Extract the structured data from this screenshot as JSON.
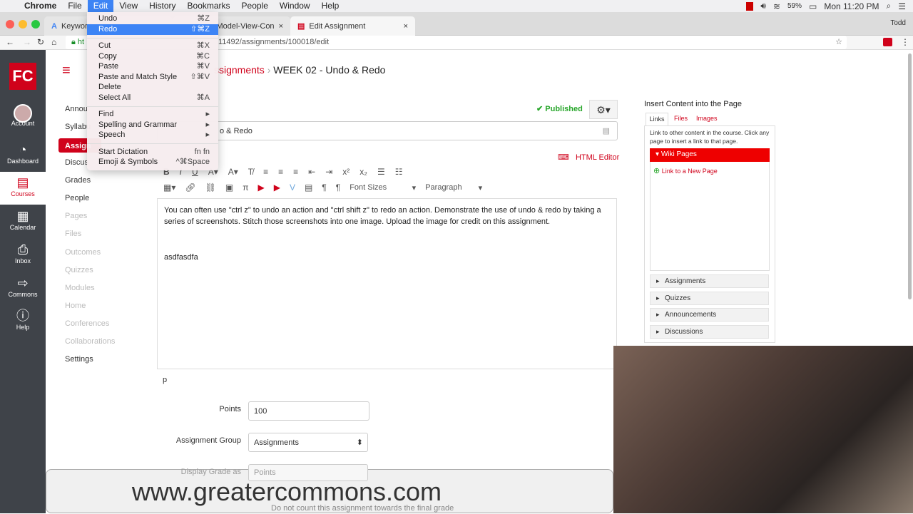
{
  "menubar": {
    "items": [
      "Chrome",
      "File",
      "Edit",
      "View",
      "History",
      "Bookmarks",
      "People",
      "Window",
      "Help"
    ],
    "active": "Edit",
    "battery": "59%",
    "clock": "Mon 11:20 PM"
  },
  "browser": {
    "tabs": [
      "Keyword",
      "e Model-View-Con",
      "Edit Assignment"
    ],
    "user": "Todd",
    "url_left": "ht",
    "url": "11492/assignments/100018/edit"
  },
  "edit_menu": [
    {
      "label": "Undo",
      "shortcut": "⌘Z"
    },
    {
      "label": "Redo",
      "shortcut": "⇧⌘Z",
      "highlighted": true
    },
    {
      "label": "Cut",
      "shortcut": "⌘X"
    },
    {
      "label": "Copy",
      "shortcut": "⌘C"
    },
    {
      "label": "Paste",
      "shortcut": "⌘V"
    },
    {
      "label": "Paste and Match Style",
      "shortcut": "⇧⌘V"
    },
    {
      "label": "Delete",
      "shortcut": ""
    },
    {
      "label": "Select All",
      "shortcut": "⌘A"
    },
    {
      "label": "Find",
      "shortcut": "▸"
    },
    {
      "label": "Spelling and Grammar",
      "shortcut": "▸"
    },
    {
      "label": "Speech",
      "shortcut": "▸"
    },
    {
      "label": "Start Dictation",
      "shortcut": "fn fn"
    },
    {
      "label": "Emoji & Symbols",
      "shortcut": "^⌘Space"
    }
  ],
  "global_nav": [
    {
      "label": "Account",
      "icon": "avatar"
    },
    {
      "label": "Dashboard",
      "icon": "dashboard-icon"
    },
    {
      "label": "Courses",
      "icon": "courses-icon",
      "selected": true
    },
    {
      "label": "Calendar",
      "icon": "calendar-icon"
    },
    {
      "label": "Inbox",
      "icon": "inbox-icon"
    },
    {
      "label": "Commons",
      "icon": "commons-icon"
    },
    {
      "label": "Help",
      "icon": "help-icon"
    }
  ],
  "course_nav": [
    {
      "label": "Annou"
    },
    {
      "label": "Syllabu"
    },
    {
      "label": "Assign",
      "active": true
    },
    {
      "label": "Discus"
    },
    {
      "label": "Grades"
    },
    {
      "label": "People"
    },
    {
      "label": "Pages",
      "dim": true
    },
    {
      "label": "Files",
      "dim": true
    },
    {
      "label": "Outcomes",
      "dim": true
    },
    {
      "label": "Quizzes",
      "dim": true
    },
    {
      "label": "Modules",
      "dim": true
    },
    {
      "label": "Home",
      "dim": true
    },
    {
      "label": "Conferences",
      "dim": true
    },
    {
      "label": "Collaborations",
      "dim": true
    },
    {
      "label": "Settings"
    }
  ],
  "breadcrumb": {
    "parent": "ssignments",
    "current": "WEEK 02 - Undo & Redo"
  },
  "status": {
    "published": "Published"
  },
  "title_field": "o & Redo",
  "html_editor": "HTML Editor",
  "toolbar": {
    "font_sizes": "Font Sizes",
    "paragraph": "Paragraph"
  },
  "editor": {
    "body": "You can often use \"ctrl z\" to undo an action and \"ctrl shift z\" to redo an action. Demonstrate the use of undo & redo by taking a series of screenshots. Stitch those screenshots into one image. Upload the image for credit on this assignment.",
    "typed": "asdfasdfa",
    "path": "p"
  },
  "form": {
    "points_label": "Points",
    "points": "100",
    "group_label": "Assignment Group",
    "group": "Assignments",
    "display_label": "Display Grade as",
    "display": "Points",
    "exclude": "Do not count this assignment towards the final grade"
  },
  "sidebar": {
    "title": "Insert Content into the Page",
    "tabs": [
      "Links",
      "Files",
      "Images"
    ],
    "help": "Link to other content in the course. Click any page to insert a link to that page.",
    "wiki": "Wiki Pages",
    "new_page": "Link to a New Page",
    "sections": [
      "Assignments",
      "Quizzes",
      "Announcements",
      "Discussions"
    ]
  },
  "watermark": "www.greatercommons.com",
  "colors": {
    "accent": "#d0021b",
    "nav": "#3f4349",
    "highlight": "#3d84f5",
    "published": "#27a62a"
  }
}
